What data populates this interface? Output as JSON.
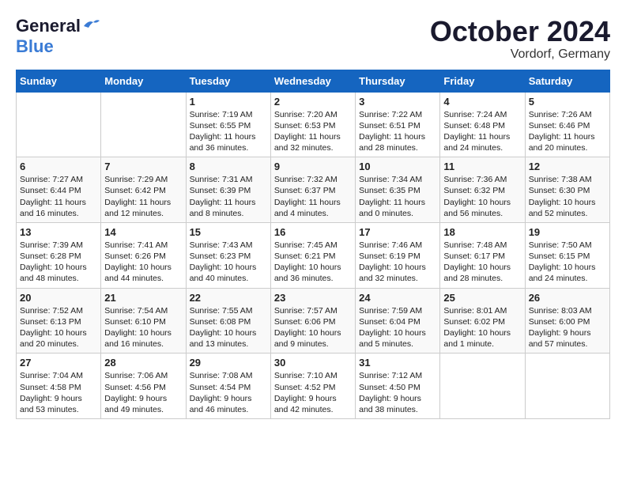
{
  "logo": {
    "line1": "General",
    "line2": "Blue"
  },
  "title": "October 2024",
  "location": "Vordorf, Germany",
  "days_header": [
    "Sunday",
    "Monday",
    "Tuesday",
    "Wednesday",
    "Thursday",
    "Friday",
    "Saturday"
  ],
  "weeks": [
    [
      {
        "day": "",
        "info": ""
      },
      {
        "day": "",
        "info": ""
      },
      {
        "day": "1",
        "info": "Sunrise: 7:19 AM\nSunset: 6:55 PM\nDaylight: 11 hours\nand 36 minutes."
      },
      {
        "day": "2",
        "info": "Sunrise: 7:20 AM\nSunset: 6:53 PM\nDaylight: 11 hours\nand 32 minutes."
      },
      {
        "day": "3",
        "info": "Sunrise: 7:22 AM\nSunset: 6:51 PM\nDaylight: 11 hours\nand 28 minutes."
      },
      {
        "day": "4",
        "info": "Sunrise: 7:24 AM\nSunset: 6:48 PM\nDaylight: 11 hours\nand 24 minutes."
      },
      {
        "day": "5",
        "info": "Sunrise: 7:26 AM\nSunset: 6:46 PM\nDaylight: 11 hours\nand 20 minutes."
      }
    ],
    [
      {
        "day": "6",
        "info": "Sunrise: 7:27 AM\nSunset: 6:44 PM\nDaylight: 11 hours\nand 16 minutes."
      },
      {
        "day": "7",
        "info": "Sunrise: 7:29 AM\nSunset: 6:42 PM\nDaylight: 11 hours\nand 12 minutes."
      },
      {
        "day": "8",
        "info": "Sunrise: 7:31 AM\nSunset: 6:39 PM\nDaylight: 11 hours\nand 8 minutes."
      },
      {
        "day": "9",
        "info": "Sunrise: 7:32 AM\nSunset: 6:37 PM\nDaylight: 11 hours\nand 4 minutes."
      },
      {
        "day": "10",
        "info": "Sunrise: 7:34 AM\nSunset: 6:35 PM\nDaylight: 11 hours\nand 0 minutes."
      },
      {
        "day": "11",
        "info": "Sunrise: 7:36 AM\nSunset: 6:32 PM\nDaylight: 10 hours\nand 56 minutes."
      },
      {
        "day": "12",
        "info": "Sunrise: 7:38 AM\nSunset: 6:30 PM\nDaylight: 10 hours\nand 52 minutes."
      }
    ],
    [
      {
        "day": "13",
        "info": "Sunrise: 7:39 AM\nSunset: 6:28 PM\nDaylight: 10 hours\nand 48 minutes."
      },
      {
        "day": "14",
        "info": "Sunrise: 7:41 AM\nSunset: 6:26 PM\nDaylight: 10 hours\nand 44 minutes."
      },
      {
        "day": "15",
        "info": "Sunrise: 7:43 AM\nSunset: 6:23 PM\nDaylight: 10 hours\nand 40 minutes."
      },
      {
        "day": "16",
        "info": "Sunrise: 7:45 AM\nSunset: 6:21 PM\nDaylight: 10 hours\nand 36 minutes."
      },
      {
        "day": "17",
        "info": "Sunrise: 7:46 AM\nSunset: 6:19 PM\nDaylight: 10 hours\nand 32 minutes."
      },
      {
        "day": "18",
        "info": "Sunrise: 7:48 AM\nSunset: 6:17 PM\nDaylight: 10 hours\nand 28 minutes."
      },
      {
        "day": "19",
        "info": "Sunrise: 7:50 AM\nSunset: 6:15 PM\nDaylight: 10 hours\nand 24 minutes."
      }
    ],
    [
      {
        "day": "20",
        "info": "Sunrise: 7:52 AM\nSunset: 6:13 PM\nDaylight: 10 hours\nand 20 minutes."
      },
      {
        "day": "21",
        "info": "Sunrise: 7:54 AM\nSunset: 6:10 PM\nDaylight: 10 hours\nand 16 minutes."
      },
      {
        "day": "22",
        "info": "Sunrise: 7:55 AM\nSunset: 6:08 PM\nDaylight: 10 hours\nand 13 minutes."
      },
      {
        "day": "23",
        "info": "Sunrise: 7:57 AM\nSunset: 6:06 PM\nDaylight: 10 hours\nand 9 minutes."
      },
      {
        "day": "24",
        "info": "Sunrise: 7:59 AM\nSunset: 6:04 PM\nDaylight: 10 hours\nand 5 minutes."
      },
      {
        "day": "25",
        "info": "Sunrise: 8:01 AM\nSunset: 6:02 PM\nDaylight: 10 hours\nand 1 minute."
      },
      {
        "day": "26",
        "info": "Sunrise: 8:03 AM\nSunset: 6:00 PM\nDaylight: 9 hours\nand 57 minutes."
      }
    ],
    [
      {
        "day": "27",
        "info": "Sunrise: 7:04 AM\nSunset: 4:58 PM\nDaylight: 9 hours\nand 53 minutes."
      },
      {
        "day": "28",
        "info": "Sunrise: 7:06 AM\nSunset: 4:56 PM\nDaylight: 9 hours\nand 49 minutes."
      },
      {
        "day": "29",
        "info": "Sunrise: 7:08 AM\nSunset: 4:54 PM\nDaylight: 9 hours\nand 46 minutes."
      },
      {
        "day": "30",
        "info": "Sunrise: 7:10 AM\nSunset: 4:52 PM\nDaylight: 9 hours\nand 42 minutes."
      },
      {
        "day": "31",
        "info": "Sunrise: 7:12 AM\nSunset: 4:50 PM\nDaylight: 9 hours\nand 38 minutes."
      },
      {
        "day": "",
        "info": ""
      },
      {
        "day": "",
        "info": ""
      }
    ]
  ]
}
